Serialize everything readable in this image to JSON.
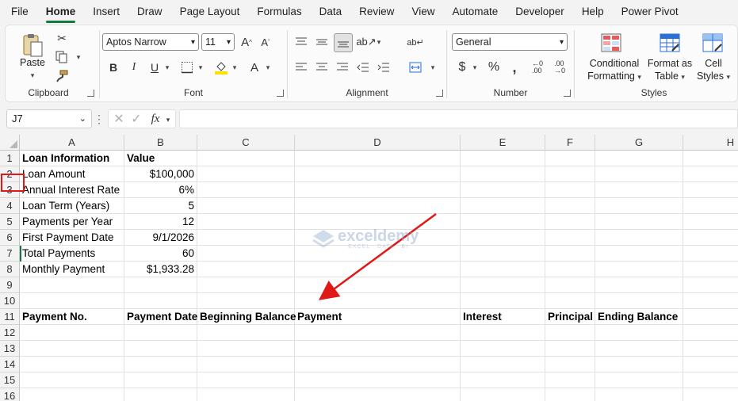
{
  "menu": {
    "tabs": [
      "File",
      "Home",
      "Insert",
      "Draw",
      "Page Layout",
      "Formulas",
      "Data",
      "Review",
      "View",
      "Automate",
      "Developer",
      "Help",
      "Power Pivot"
    ],
    "active_tab": "Home"
  },
  "ribbon": {
    "clipboard": {
      "label": "Clipboard",
      "paste": "Paste"
    },
    "font": {
      "label": "Font",
      "font_name": "Aptos Narrow",
      "font_size": "11"
    },
    "alignment": {
      "label": "Alignment"
    },
    "number": {
      "label": "Number",
      "format": "General"
    },
    "styles": {
      "label": "Styles",
      "conditional_formatting": [
        "Conditional",
        "Formatting"
      ],
      "format_as_table": [
        "Format as",
        "Table"
      ],
      "cell_styles": [
        "Cell",
        "Styles"
      ]
    }
  },
  "formula_bar": {
    "name_box": "J7",
    "fx": "fx",
    "formula": ""
  },
  "sheet": {
    "columns": [
      "A",
      "B",
      "C",
      "D",
      "E",
      "F",
      "G",
      "H"
    ],
    "row_numbers": [
      "1",
      "2",
      "3",
      "4",
      "5",
      "6",
      "7",
      "8",
      "9",
      "10",
      "11",
      "12",
      "13",
      "14",
      "15",
      "16"
    ],
    "rows": [
      [
        "Loan Information",
        "Value",
        "",
        "",
        "",
        "",
        "",
        ""
      ],
      [
        "Loan Amount",
        "$100,000",
        "",
        "",
        "",
        "",
        "",
        ""
      ],
      [
        "Annual Interest Rate",
        "6%",
        "",
        "",
        "",
        "",
        "",
        ""
      ],
      [
        "Loan Term (Years)",
        "5",
        "",
        "",
        "",
        "",
        "",
        ""
      ],
      [
        "Payments per Year",
        "12",
        "",
        "",
        "",
        "",
        "",
        ""
      ],
      [
        "First Payment Date",
        "9/1/2026",
        "",
        "",
        "",
        "",
        "",
        ""
      ],
      [
        "Total Payments",
        "60",
        "",
        "",
        "",
        "",
        "",
        ""
      ],
      [
        "Monthly Payment",
        "$1,933.28",
        "",
        "",
        "",
        "",
        "",
        ""
      ],
      [
        "",
        "",
        "",
        "",
        "",
        "",
        "",
        ""
      ],
      [
        "",
        "",
        "",
        "",
        "",
        "",
        "",
        ""
      ],
      [
        "Payment No.",
        "Payment Date",
        "Beginning Balance",
        "Payment",
        "Interest",
        "Principal",
        "Ending Balance",
        ""
      ],
      [
        "",
        "",
        "",
        "",
        "",
        "",
        "",
        ""
      ],
      [
        "",
        "",
        "",
        "",
        "",
        "",
        "",
        ""
      ],
      [
        "",
        "",
        "",
        "",
        "",
        "",
        "",
        ""
      ],
      [
        "",
        "",
        "",
        "",
        "",
        "",
        "",
        ""
      ],
      [
        "",
        "",
        "",
        "",
        "",
        "",
        "",
        ""
      ]
    ]
  },
  "watermark": {
    "brand": "exceldemy",
    "tagline": "EXCEL · DATA · BI"
  },
  "colors": {
    "accent": "#0f7b3f",
    "highlight_box": "#e01818",
    "arrow": "#e01818"
  }
}
